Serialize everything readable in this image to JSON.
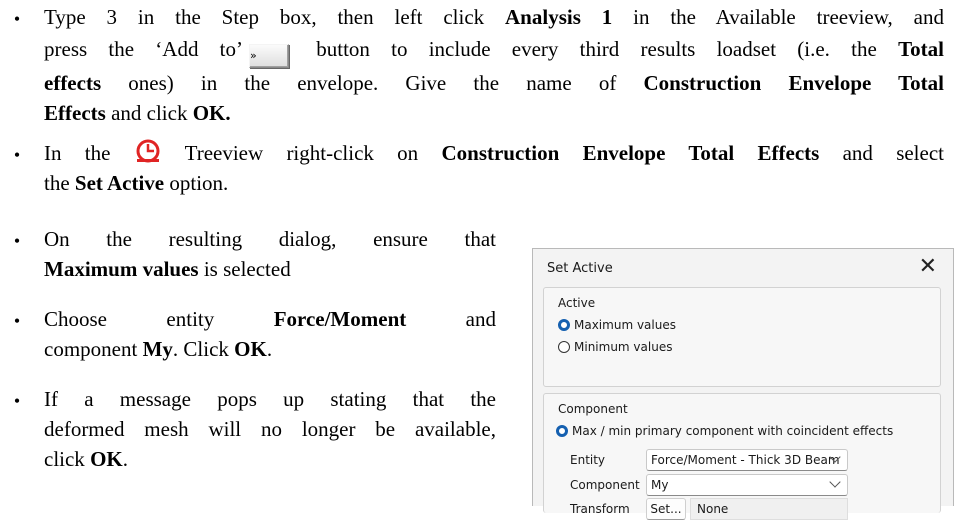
{
  "bullets": {
    "b1": {
      "line1_a": "Type 3 in the Step box, then left click ",
      "line1_b": "Analysis 1",
      "line1_c": " in the Available treeview, and",
      "line2_a": "press the ‘Add to’",
      "line2_b": " button to include every third results loadset (i.e. the ",
      "line2_c": "Total",
      "line3_a": "effects",
      "line3_b": " ones) in the envelope. Give the name of ",
      "line3_c": "Construction Envelope Total",
      "line4_a": "Effects",
      "line4_b": " and click ",
      "line4_c": "OK."
    },
    "b2": {
      "line1_a": "In the ",
      "line1_b": " Treeview right-click on ",
      "line1_c": "Construction Envelope Total Effects",
      "line1_d": " and select",
      "line2_a": "the ",
      "line2_b": "Set Active",
      "line2_c": " option."
    },
    "b3": {
      "line1": "On the resulting dialog, ensure that",
      "line2_a": "Maximum values",
      "line2_b": " is selected"
    },
    "b4": {
      "line1_a": "Choose entity ",
      "line1_b": "Force/Moment",
      "line1_c": " and",
      "line2_a": "component ",
      "line2_b": "My",
      "line2_c": ". Click ",
      "line2_d": "OK",
      "line2_e": "."
    },
    "b5": {
      "line1": "If a message pops up stating that the",
      "line2": "deformed mesh will no longer be available,",
      "line3_a": "click ",
      "line3_b": "OK",
      "line3_c": "."
    },
    "bullet_char": "•"
  },
  "add_button_label": "»",
  "icons": {
    "add_to": "double-chevron-right-icon",
    "treeview": "clock-loadcase-icon",
    "close": "close-icon",
    "dropdown": "chevron-down-icon"
  },
  "dialog": {
    "title": "Set Active",
    "close_glyph": "✕",
    "active_group": {
      "label": "Active",
      "options": [
        "Maximum values",
        "Minimum values"
      ],
      "selected": "Maximum values"
    },
    "component_group": {
      "label": "Component",
      "mode_option": "Max / min primary component with coincident effects",
      "entity_label": "Entity",
      "entity_value": "Force/Moment - Thick 3D Beam",
      "component_label": "Component",
      "component_value": "My",
      "transform_label": "Transform",
      "transform_button": "Set...",
      "transform_value": "None"
    }
  },
  "colors": {
    "radio_selected": "#1560b0",
    "icon_red": "#e02424"
  }
}
